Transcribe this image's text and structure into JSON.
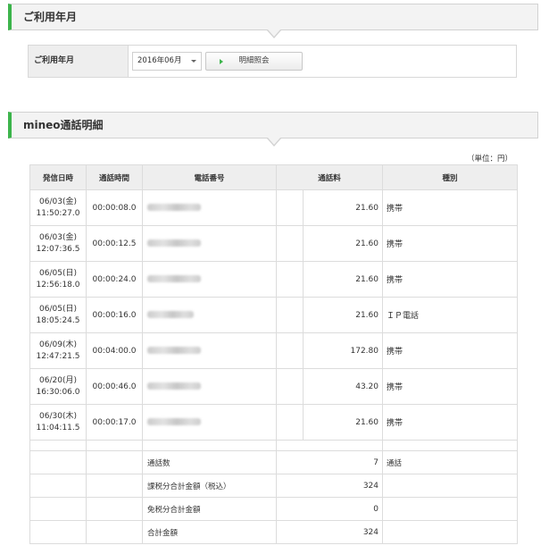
{
  "section1": {
    "title": "ご利用年月"
  },
  "month_form": {
    "label": "ご利用年月",
    "selected_month": "2016年06月",
    "button_label": "明細照会"
  },
  "section2": {
    "title": "mineo通話明細"
  },
  "unit_note": "（単位：円）",
  "table": {
    "headers": [
      "発信日時",
      "通話時間",
      "電話番号",
      "通話料",
      "種別"
    ],
    "rows": [
      {
        "date": "06/03(金)",
        "time": "11:50:27.0",
        "duration": "00:00:08.0",
        "fee": "21.60",
        "type": "携帯"
      },
      {
        "date": "06/03(金)",
        "time": "12:07:36.5",
        "duration": "00:00:12.5",
        "fee": "21.60",
        "type": "携帯"
      },
      {
        "date": "06/05(日)",
        "time": "12:56:18.0",
        "duration": "00:00:24.0",
        "fee": "21.60",
        "type": "携帯"
      },
      {
        "date": "06/05(日)",
        "time": "18:05:24.5",
        "duration": "00:00:16.0",
        "fee": "21.60",
        "type": "ＩＰ電話"
      },
      {
        "date": "06/09(木)",
        "time": "12:47:21.5",
        "duration": "00:04:00.0",
        "fee": "172.80",
        "type": "携帯"
      },
      {
        "date": "06/20(月)",
        "time": "16:30:06.0",
        "duration": "00:00:46.0",
        "fee": "43.20",
        "type": "携帯"
      },
      {
        "date": "06/30(木)",
        "time": "11:04:11.5",
        "duration": "00:00:17.0",
        "fee": "21.60",
        "type": "携帯"
      }
    ],
    "summary": [
      {
        "label": "通話数",
        "value": "7",
        "unit": "通話"
      },
      {
        "label": "課税分合計金額（税込）",
        "value": "324",
        "unit": ""
      },
      {
        "label": "免税分合計金額",
        "value": "0",
        "unit": ""
      },
      {
        "label": "合計金額",
        "value": "324",
        "unit": ""
      }
    ]
  },
  "colors": {
    "accent": "#3cb44b",
    "header_bg": "#f3f3f3",
    "border": "#dcdcdc"
  }
}
